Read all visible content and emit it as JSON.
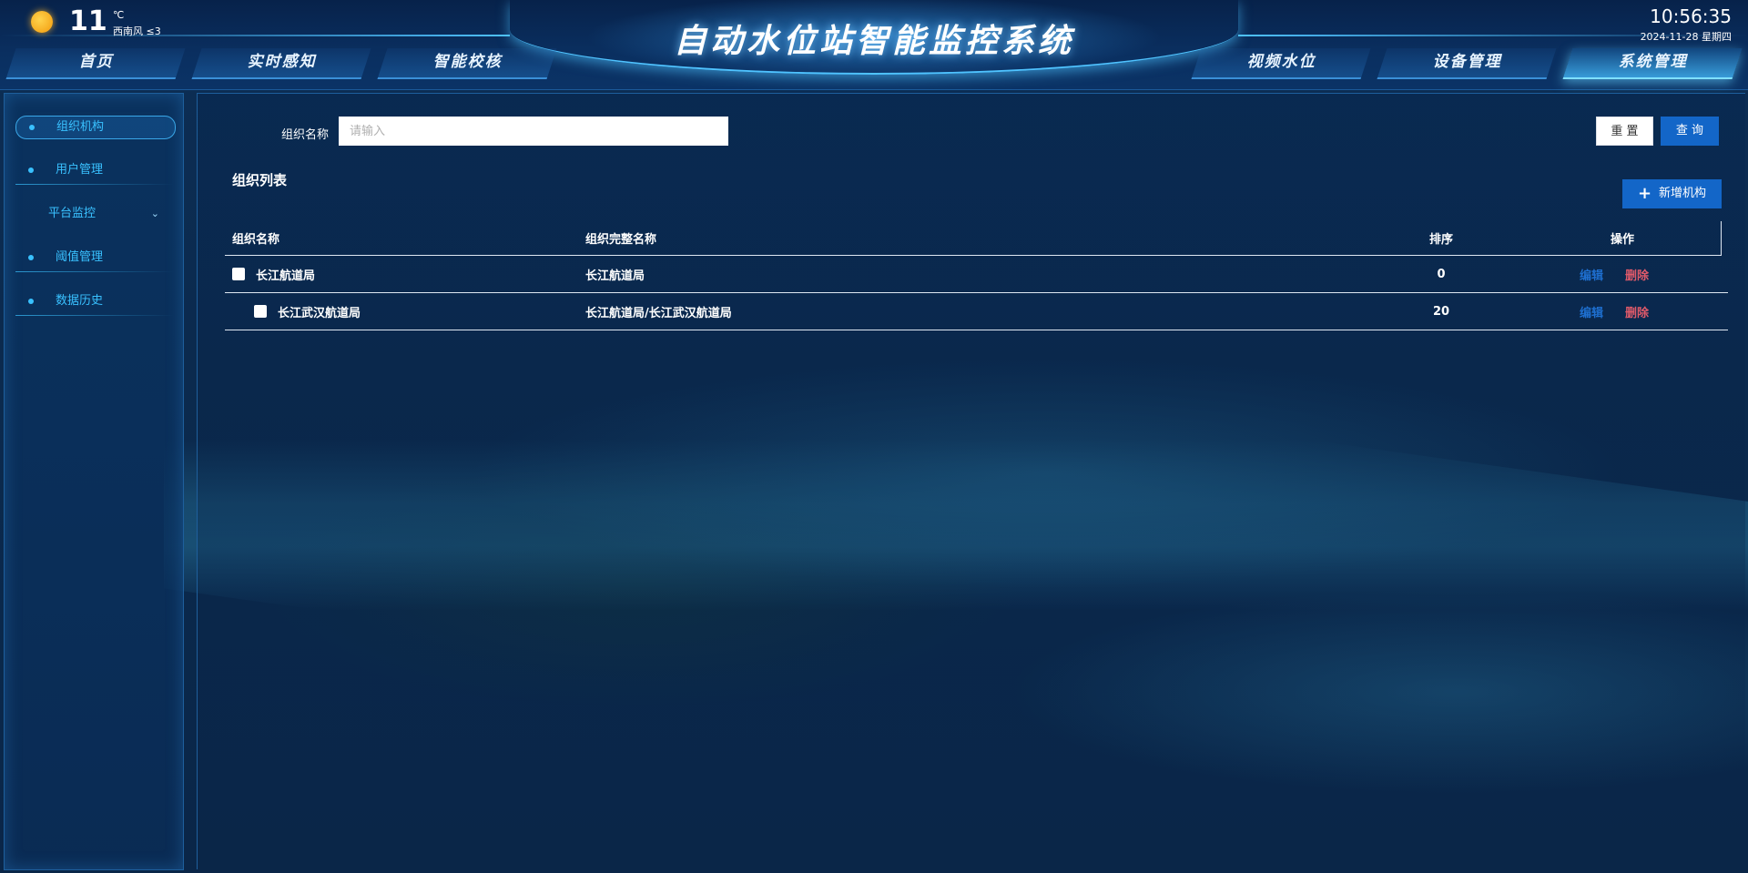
{
  "header": {
    "title": "自动水位站智能监控系统",
    "weather": {
      "icon": "sun-icon",
      "temperature": "11",
      "unit": "℃",
      "wind": "西南风 ≤3"
    },
    "clock": {
      "time": "10:56:35",
      "date": "2024-11-28 星期四"
    },
    "nav": [
      {
        "label": "首页",
        "active": false
      },
      {
        "label": "实时感知",
        "active": false
      },
      {
        "label": "智能校核",
        "active": false
      },
      {
        "label": "视频水位",
        "active": false
      },
      {
        "label": "设备管理",
        "active": false
      },
      {
        "label": "系统管理",
        "active": true
      }
    ]
  },
  "sidebar": {
    "items": [
      {
        "label": "组织机构",
        "active": true
      },
      {
        "label": "用户管理",
        "active": false
      },
      {
        "label": "平台监控",
        "active": false,
        "expandable": true,
        "icon": "chevron-down-icon"
      },
      {
        "label": "阈值管理",
        "active": false
      },
      {
        "label": "数据历史",
        "active": false
      }
    ]
  },
  "filter": {
    "label": "组织名称",
    "placeholder": "请输入",
    "value": "",
    "reset_label": "重 置",
    "query_label": "查 询"
  },
  "list": {
    "title": "组织列表",
    "add_label": "新增机构",
    "add_icon": "plus-icon",
    "columns": [
      "组织名称",
      "组织完整名称",
      "排序",
      "操作"
    ],
    "rows": [
      {
        "name": "长江航道局",
        "full_name": "长江航道局",
        "sort": "0",
        "edit": "编辑",
        "delete": "删除",
        "level": 0
      },
      {
        "name": "长江武汉航道局",
        "full_name": "长江航道局/长江武汉航道局",
        "sort": "20",
        "edit": "编辑",
        "delete": "删除",
        "level": 1
      }
    ]
  },
  "colors": {
    "accent": "#39c1ff",
    "primary_button": "#1366c8",
    "edit_link": "#1e6fd0",
    "delete_link": "#e05a6a"
  }
}
